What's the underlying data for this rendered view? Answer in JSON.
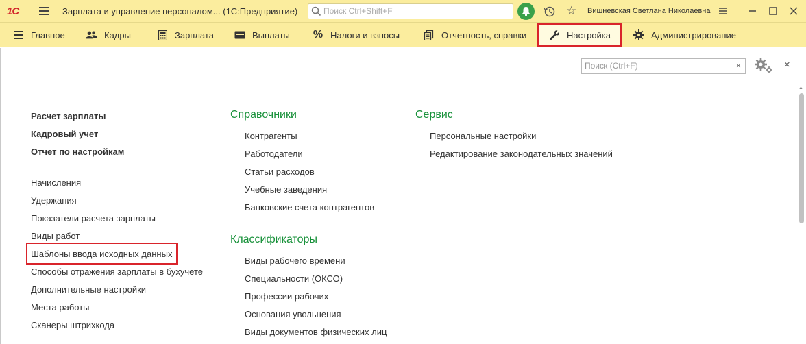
{
  "titlebar": {
    "logo": "1С",
    "app_title": "Зарплата и управление персоналом...  (1С:Предприятие)",
    "search_placeholder": "Поиск Ctrl+Shift+F",
    "user_name": "Вишневская Светлана Николаевна"
  },
  "sections": [
    {
      "label": "Главное",
      "icon": "menu-icon"
    },
    {
      "label": "Кадры",
      "icon": "people-icon"
    },
    {
      "label": "Зарплата",
      "icon": "calculator-icon"
    },
    {
      "label": "Выплаты",
      "icon": "wallet-icon"
    },
    {
      "label": "Налоги и взносы",
      "icon": "percent-icon"
    },
    {
      "label": "Отчетность, справки",
      "icon": "reports-icon"
    },
    {
      "label": "Настройка",
      "icon": "wrench-icon",
      "active": true
    },
    {
      "label": "Администрирование",
      "icon": "gear-icon"
    }
  ],
  "panel": {
    "search_placeholder": "Поиск (Ctrl+F)",
    "clear_label": "×",
    "close_label": "×"
  },
  "left_column": {
    "bold_links": [
      "Расчет зарплаты",
      "Кадровый учет",
      "Отчет по настройкам"
    ],
    "links": [
      "Начисления",
      "Удержания",
      "Показатели расчета зарплаты",
      "Виды работ",
      "Шаблоны ввода исходных данных",
      "Способы отражения зарплаты в бухучете",
      "Дополнительные настройки",
      "Места работы",
      "Сканеры штрихкода"
    ]
  },
  "middle_column": {
    "group1_title": "Справочники",
    "group1_links": [
      "Контрагенты",
      "Работодатели",
      "Статьи расходов",
      "Учебные заведения",
      "Банковские счета контрагентов"
    ],
    "group2_title": "Классификаторы",
    "group2_links": [
      "Виды рабочего времени",
      "Специальности (ОКСО)",
      "Профессии рабочих",
      "Основания увольнения",
      "Виды документов физических лиц"
    ]
  },
  "right_column": {
    "group_title": "Сервис",
    "links": [
      "Персональные настройки",
      "Редактирование законодательных значений"
    ]
  },
  "colors": {
    "panel_bg": "#fbed9e",
    "group_title": "#18913a",
    "highlight": "#d9242b"
  }
}
